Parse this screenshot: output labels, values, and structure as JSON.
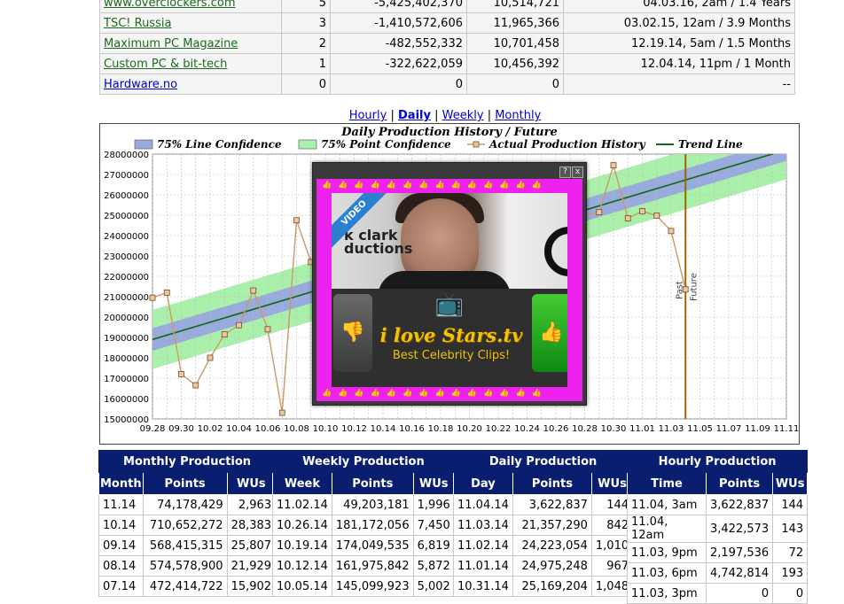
{
  "team_table": {
    "rows": [
      {
        "name": "www.overclockers.com",
        "rank": "5",
        "points": "-5,425,402,370",
        "wus": "10,514,721",
        "date": "04.03.16, 2am / 1.4 Years",
        "link_color": "green"
      },
      {
        "name": "TSC! Russia",
        "rank": "3",
        "points": "-1,410,572,606",
        "wus": "11,965,366",
        "date": "03.02.15, 12am / 3.9 Months",
        "link_color": "green"
      },
      {
        "name": "Maximum PC Magazine",
        "rank": "2",
        "points": "-482,552,332",
        "wus": "10,701,458",
        "date": "12.19.14, 5am / 1.5 Months",
        "link_color": "green"
      },
      {
        "name": "Custom PC & bit-tech",
        "rank": "1",
        "points": "-322,622,059",
        "wus": "10,456,392",
        "date": "12.04.14, 11pm / 1 Month",
        "link_color": "green"
      },
      {
        "name": "Hardware.no",
        "rank": "0",
        "points": "0",
        "wus": "0",
        "date": "--",
        "link_color": "blue"
      }
    ]
  },
  "chart_nav": {
    "hourly": "Hourly",
    "daily": "Daily",
    "weekly": "Weekly",
    "monthly": "Monthly",
    "sep": "|"
  },
  "chart_data": {
    "type": "line",
    "title": "Daily Production History / Future",
    "legend": [
      {
        "name": "75% Line Confidence",
        "color": "#99aadd",
        "kind": "box"
      },
      {
        "name": "75% Point Confidence",
        "color": "#aaf0aa",
        "kind": "box"
      },
      {
        "name": "Actual Production History",
        "color": "#cc9966",
        "kind": "line-marker"
      },
      {
        "name": "Trend Line",
        "color": "#116611",
        "kind": "line"
      }
    ],
    "legend_position": "top",
    "y_ticks": [
      "15000000",
      "16000000",
      "17000000",
      "18000000",
      "19000000",
      "20000000",
      "21000000",
      "22000000",
      "23000000",
      "24000000",
      "25000000",
      "26000000",
      "27000000",
      "28000000"
    ],
    "ylim": [
      15000000,
      28000000
    ],
    "x_ticks": [
      "09.28",
      "09.30",
      "10.02",
      "10.04",
      "10.06",
      "10.08",
      "10.10",
      "10.12",
      "10.14",
      "10.16",
      "10.18",
      "10.20",
      "10.22",
      "10.24",
      "10.26",
      "10.28",
      "10.30",
      "11.01",
      "11.03",
      "11.05",
      "11.07",
      "11.09",
      "11.11"
    ],
    "x_range_days": [
      0,
      44
    ],
    "grid": true,
    "past_label": "Past",
    "future_label": "Future",
    "divider_day": 37,
    "history": [
      {
        "day": 0,
        "value": 20950000
      },
      {
        "day": 1,
        "value": 21200000
      },
      {
        "day": 2,
        "value": 17200000
      },
      {
        "day": 3,
        "value": 16650000
      },
      {
        "day": 4,
        "value": 18000000
      },
      {
        "day": 5,
        "value": 19150000
      },
      {
        "day": 6,
        "value": 19600000
      },
      {
        "day": 7,
        "value": 21300000
      },
      {
        "day": 8,
        "value": 19400000
      },
      {
        "day": 9,
        "value": 15300000
      },
      {
        "day": 10,
        "value": 24750000
      },
      {
        "day": 11,
        "value": 22700000
      },
      {
        "day": 31,
        "value": 25150000
      },
      {
        "day": 32,
        "value": 27450000
      },
      {
        "day": 33,
        "value": 24850000
      },
      {
        "day": 34,
        "value": 25200000
      },
      {
        "day": 35,
        "value": 24975248
      },
      {
        "day": 36,
        "value": 24223054
      },
      {
        "day": 37,
        "value": 21357290
      }
    ],
    "trend": [
      {
        "day": 0,
        "value": 18900000
      },
      {
        "day": 43,
        "value": 28000000
      }
    ],
    "line_confidence_half_width": 550000,
    "point_confidence_half_width": 1450000
  },
  "ad_popup": {
    "help": "?",
    "close": "x",
    "ribbon": "VIDEO",
    "clip_logo": "k clark\nductions",
    "brand": "i love Stars.tv",
    "tagline": "Best Celebrity Clips!",
    "tv_icon": "tv-icon",
    "thumbs_down": "👎",
    "thumbs_up": "👍",
    "border_thumb": "👍"
  },
  "production_tables": [
    {
      "title": "Monthly Production",
      "columns": [
        "Month",
        "Points",
        "WUs"
      ],
      "rows": [
        [
          "11.14",
          "74,178,429",
          "2,963"
        ],
        [
          "10.14",
          "710,652,272",
          "28,383"
        ],
        [
          "09.14",
          "568,415,315",
          "25,807"
        ],
        [
          "08.14",
          "574,578,900",
          "21,929"
        ],
        [
          "07.14",
          "472,414,722",
          "15,902"
        ]
      ]
    },
    {
      "title": "Weekly Production",
      "columns": [
        "Week",
        "Points",
        "WUs"
      ],
      "rows": [
        [
          "11.02.14",
          "49,203,181",
          "1,996"
        ],
        [
          "10.26.14",
          "181,172,056",
          "7,450"
        ],
        [
          "10.19.14",
          "174,049,535",
          "6,819"
        ],
        [
          "10.12.14",
          "161,975,842",
          "5,872"
        ],
        [
          "10.05.14",
          "145,099,923",
          "5,002"
        ]
      ]
    },
    {
      "title": "Daily Production",
      "columns": [
        "Day",
        "Points",
        "WUs"
      ],
      "rows": [
        [
          "11.04.14",
          "3,622,837",
          "144"
        ],
        [
          "11.03.14",
          "21,357,290",
          "842"
        ],
        [
          "11.02.14",
          "24,223,054",
          "1,010"
        ],
        [
          "11.01.14",
          "24,975,248",
          "967"
        ],
        [
          "10.31.14",
          "25,169,204",
          "1,048"
        ]
      ]
    },
    {
      "title": "Hourly Production",
      "columns": [
        "Time",
        "Points",
        "WUs"
      ],
      "rows": [
        [
          "11.04, 3am",
          "3,622,837",
          "144"
        ],
        [
          "11.04, 12am",
          "3,422,573",
          "143"
        ],
        [
          "11.03, 9pm",
          "2,197,536",
          "72"
        ],
        [
          "11.03, 6pm",
          "4,742,814",
          "193"
        ],
        [
          "11.03, 3pm",
          "0",
          "0"
        ]
      ]
    }
  ]
}
